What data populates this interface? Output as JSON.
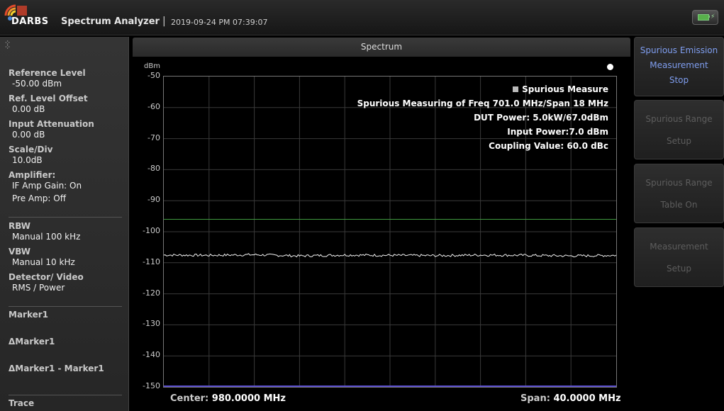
{
  "header": {
    "brand": "DARBS",
    "app_title": "Spectrum Analyzer",
    "separator": "|",
    "datetime": "2019-09-24 PM 07:39:07",
    "icons": [
      "darbs-logo-icon",
      "battery-icon"
    ]
  },
  "left_panel": {
    "reference_level_label": "Reference Level",
    "reference_level_value": "-50.00 dBm",
    "ref_offset_label": "Ref. Level Offset",
    "ref_offset_value": "0.00 dB",
    "input_atten_label": "Input Attenuation",
    "input_atten_value": "0.00 dB",
    "scale_label": "Scale/Div",
    "scale_value": "10.0dB",
    "amplifier_label": "Amplifier:",
    "if_amp_gain": "IF Amp Gain: On",
    "pre_amp": "Pre Amp: Off",
    "rbw_label": "RBW",
    "rbw_value": "Manual 100 kHz",
    "vbw_label": "VBW",
    "vbw_value": "Manual 10 kHz",
    "detector_label": "Detector/ Video",
    "detector_value": "RMS / Power",
    "marker1_label": "Marker1",
    "dmarker1_label": "ΔMarker1",
    "dmarker_diff_label": "ΔMarker1 - Marker1",
    "trace_label": "Trace"
  },
  "spectrum": {
    "title": "Spectrum",
    "unit": "dBm",
    "y_ticks": [
      "-50",
      "-60",
      "-70",
      "-80",
      "-90",
      "-100",
      "-110",
      "-120",
      "-130",
      "-140",
      "-150"
    ],
    "info_lines": [
      "Spurious Measure",
      "Spurious Measuring of Freq 701.0 MHz/Span 18 MHz",
      "DUT Power: 5.0kW/67.0dBm",
      "Input Power:7.0 dBm",
      "Coupling Value: 60.0 dBc"
    ],
    "center_label": "Center:",
    "center_value": "980.0000 MHz",
    "span_label": "Span:",
    "span_value": "40.0000 MHz"
  },
  "chart_data": {
    "type": "line",
    "ylabel": "dBm",
    "ylim": [
      -150,
      -50
    ],
    "grid": true,
    "series": [
      {
        "color": "#3f9a3f",
        "values": [
          -96,
          -96
        ]
      },
      {
        "color": "#f2f2f2",
        "values": [
          -107.5,
          -107.6,
          -107.4,
          -107.8,
          -107.5,
          -107.6,
          -107.7,
          -107.5,
          -107.6,
          -107.8,
          -107.6
        ]
      }
    ],
    "colors": {
      "limit_line": "#3f9a3f",
      "trace": "#f2f2f2",
      "grid": "#3a3a3a",
      "baseline": "#5a4fd0"
    }
  },
  "right_panel": {
    "buttons": [
      {
        "lines": [
          "Spurious Emission",
          "Measurement",
          "Stop"
        ],
        "state": "active"
      },
      {
        "lines": [
          "Spurious Range",
          "Setup"
        ],
        "state": "disabled"
      },
      {
        "lines": [
          "Spurious Range",
          "Table On"
        ],
        "state": "disabled"
      },
      {
        "lines": [
          "Measurement",
          "Setup"
        ],
        "state": "disabled"
      }
    ]
  },
  "colors": {
    "accent": "#7f9ef0",
    "disabled": "#5d5d5d"
  }
}
